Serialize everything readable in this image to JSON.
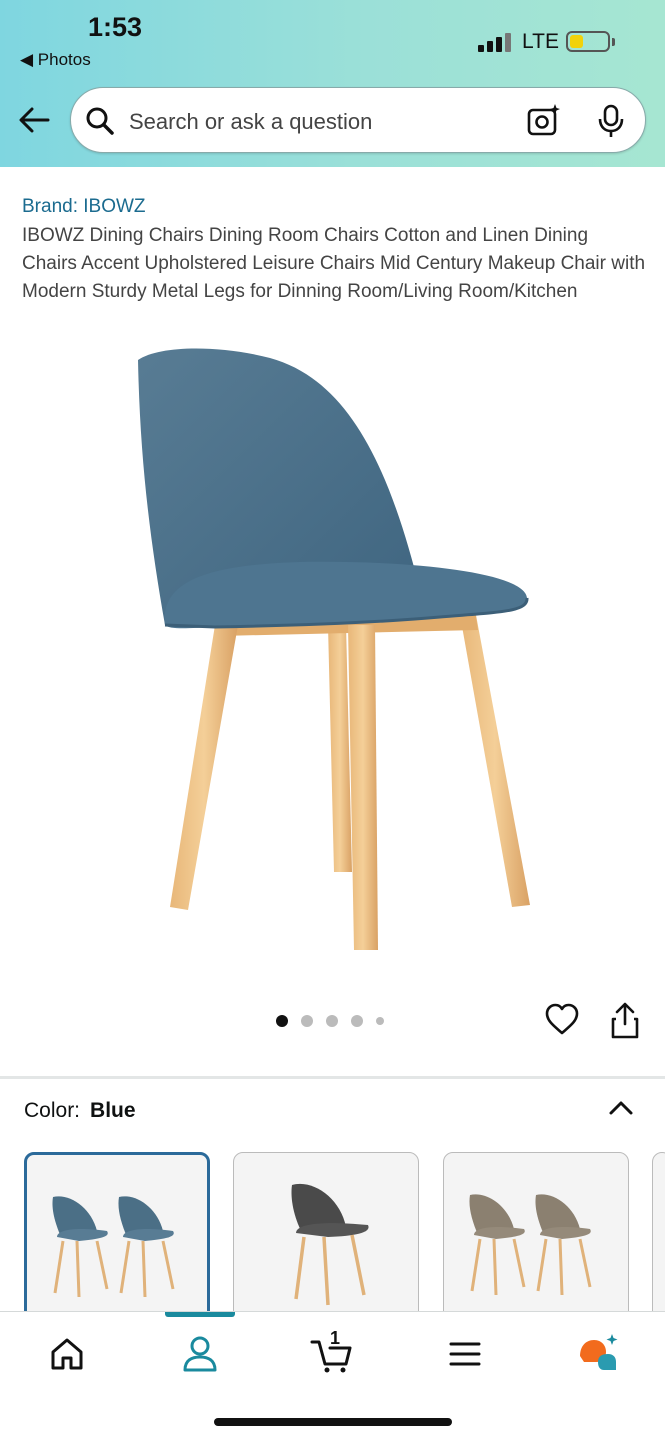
{
  "status_bar": {
    "time": "1:53",
    "back_app": "◀ Photos",
    "network": "LTE",
    "battery_level": 0.35,
    "battery_color": "#f2d20a"
  },
  "search": {
    "placeholder": "Search or ask a question"
  },
  "product": {
    "brand": "Brand: IBOWZ",
    "title": "IBOWZ Dining Chairs Dining Room Chairs Cotton and Linen Dining Chairs Accent Upholstered Leisure Chairs Mid Century Makeup Chair with Modern Sturdy Metal Legs for Dinning Room/Living Room/Kitchen",
    "image_count": 5,
    "current_image": 1
  },
  "variation": {
    "label": "Color:",
    "selected": "Blue",
    "swatches": [
      {
        "icon": "blue-chair-pair",
        "selected": true,
        "color": "#4b6f86"
      },
      {
        "icon": "dark-grey-chair",
        "selected": false,
        "color": "#4a4a4a"
      },
      {
        "icon": "taupe-chair-pair",
        "selected": false,
        "color": "#8b8070"
      }
    ]
  },
  "tab_bar": {
    "items": [
      "home-icon",
      "account-icon",
      "cart-icon",
      "menu-icon",
      "rufus-icon"
    ],
    "active": "account-icon",
    "cart_count": "1"
  },
  "colors": {
    "accent": "#1a8a9e",
    "brand_link": "#1b6b8f",
    "swatch_selected_border": "#2b6a9a"
  }
}
